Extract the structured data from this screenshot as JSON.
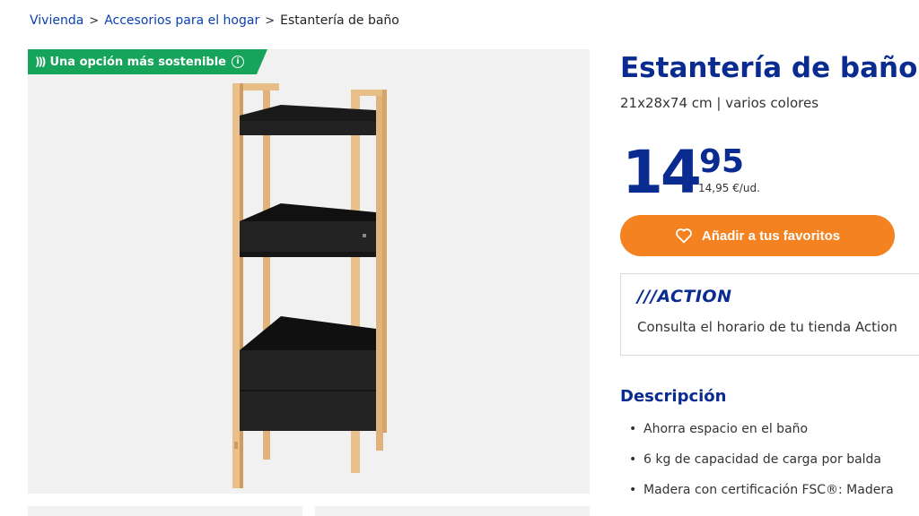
{
  "breadcrumb": {
    "items": [
      "Vivienda",
      "Accesorios para el hogar"
    ],
    "current": "Estantería de baño"
  },
  "badge": {
    "label": "Una opción más sostenible"
  },
  "product": {
    "title": "Estantería de baño",
    "subtitle": "21x28x74 cm | varios colores",
    "price_int": "14",
    "price_dec": "95",
    "unit_price": "14,95 €/ud."
  },
  "actions": {
    "favorite_label": "Añadir a tus favoritos"
  },
  "store": {
    "logo": "///ACTION",
    "text": "Consulta el horario de tu tienda Action"
  },
  "description": {
    "title": "Descripción",
    "items": [
      "Ahorra espacio en el baño",
      "6 kg de capacidad de carga por balda",
      "Madera con certificación FSC®: Madera"
    ]
  },
  "colors": {
    "accent": "#0a2b8f",
    "link": "#0b3fae",
    "badge": "#16a35a",
    "button": "#f58220",
    "gallery_bg": "#f1f1f1"
  }
}
